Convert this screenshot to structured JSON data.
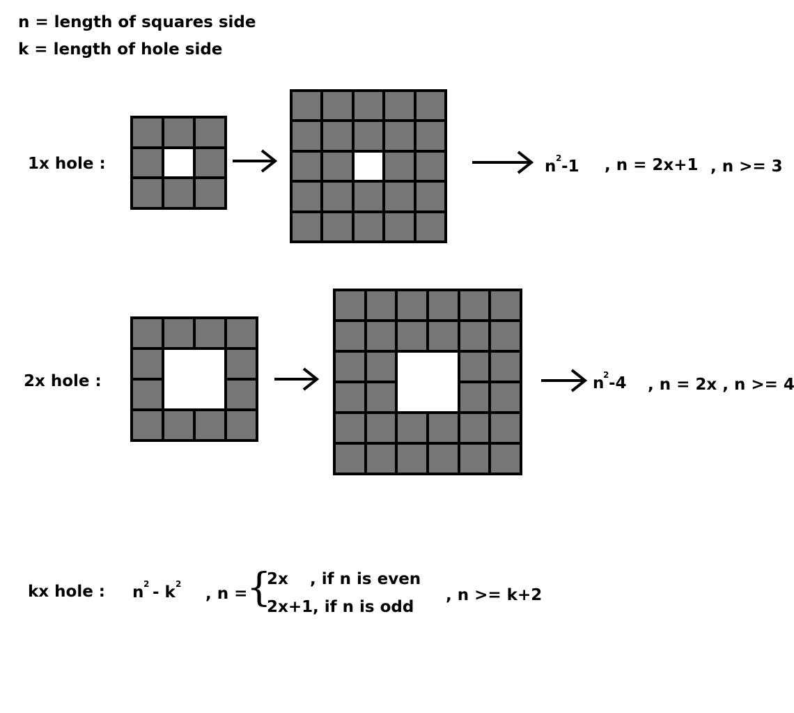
{
  "definitions": {
    "n_def": "n = length of squares side",
    "k_def": "k = length of hole side"
  },
  "row1": {
    "label": "1x hole :",
    "formula_base": "n",
    "formula_exp": "2",
    "formula_rest": "-1",
    "cond1": ", n = 2x+1",
    "cond2": ", n >= 3",
    "small_grid": {
      "size": 3,
      "hole": [
        [
          1,
          1
        ]
      ]
    },
    "large_grid": {
      "size": 5,
      "hole": [
        [
          2,
          2
        ]
      ]
    }
  },
  "row2": {
    "label": "2x hole :",
    "formula_base": "n",
    "formula_exp": "2",
    "formula_rest": "-4",
    "cond1": ", n = 2x , n >= 4",
    "small_grid": {
      "size": 4,
      "hole": [
        [
          1,
          1
        ],
        [
          1,
          2
        ],
        [
          2,
          1
        ],
        [
          2,
          2
        ]
      ]
    },
    "large_grid": {
      "size": 6,
      "hole": [
        [
          2,
          2
        ],
        [
          2,
          3
        ],
        [
          3,
          2
        ],
        [
          3,
          3
        ]
      ]
    }
  },
  "row3": {
    "label": "kx hole :",
    "formula_n": "n",
    "formula_n_exp": "2",
    "formula_minus": "- k",
    "formula_k_exp": "2",
    "n_eq": ", n =",
    "brace": "{",
    "case1_val": "2x",
    "case1_cond": ", if n is even",
    "case2_val": "2x+1",
    "case2_cond": ", if n is odd",
    "cond": ", n >= k+2"
  }
}
